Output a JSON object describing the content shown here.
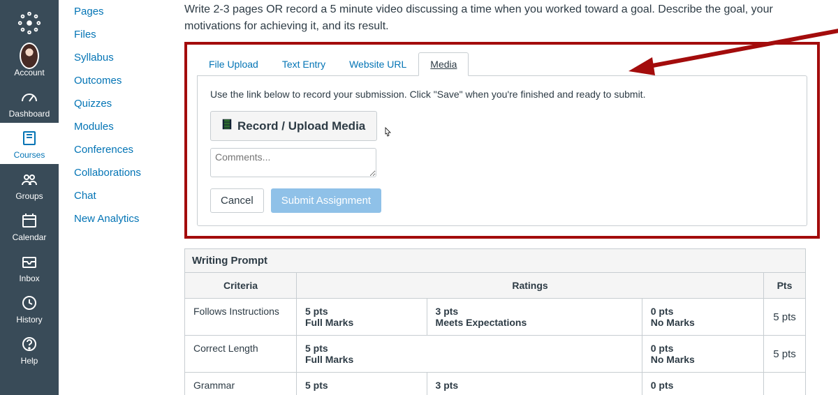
{
  "global_nav": {
    "logo_alt": "canvas-logo",
    "items": [
      {
        "id": "account",
        "label": "Account"
      },
      {
        "id": "dashboard",
        "label": "Dashboard"
      },
      {
        "id": "courses",
        "label": "Courses"
      },
      {
        "id": "groups",
        "label": "Groups"
      },
      {
        "id": "calendar",
        "label": "Calendar"
      },
      {
        "id": "inbox",
        "label": "Inbox"
      },
      {
        "id": "history",
        "label": "History"
      },
      {
        "id": "help",
        "label": "Help"
      }
    ],
    "active": "courses"
  },
  "course_nav": {
    "links": [
      "Pages",
      "Files",
      "Syllabus",
      "Outcomes",
      "Quizzes",
      "Modules",
      "Conferences",
      "Collaborations",
      "Chat",
      "New Analytics"
    ]
  },
  "assignment": {
    "prompt": "Write 2-3 pages OR record a 5 minute video discussing a time when you worked toward a goal. Describe the goal, your motivations for achieving it, and its result.",
    "tabs": [
      "File Upload",
      "Text Entry",
      "Website URL",
      "Media"
    ],
    "active_tab": "Media",
    "media_instruction": "Use the link below to record your submission. Click \"Save\" when you're finished and ready to submit.",
    "record_button_label": "Record / Upload Media",
    "comments_placeholder": "Comments...",
    "cancel_label": "Cancel",
    "submit_label": "Submit Assignment"
  },
  "rubric": {
    "title": "Writing Prompt",
    "headers": {
      "criteria": "Criteria",
      "ratings": "Ratings",
      "pts": "Pts"
    },
    "rows": [
      {
        "criterion": "Follows Instructions",
        "ratings": [
          {
            "pts": "5 pts",
            "label": "Full Marks"
          },
          {
            "pts": "3 pts",
            "label": "Meets Expectations"
          },
          {
            "pts": "0 pts",
            "label": "No Marks"
          }
        ],
        "total": "5 pts"
      },
      {
        "criterion": "Correct Length",
        "ratings": [
          {
            "pts": "5 pts",
            "label": "Full Marks"
          },
          {
            "pts": "0 pts",
            "label": "No Marks"
          }
        ],
        "total": "5 pts"
      },
      {
        "criterion": "Grammar",
        "ratings": [
          {
            "pts": "5 pts",
            "label": ""
          },
          {
            "pts": "3 pts",
            "label": ""
          },
          {
            "pts": "0 pts",
            "label": ""
          }
        ],
        "total": ""
      }
    ]
  }
}
